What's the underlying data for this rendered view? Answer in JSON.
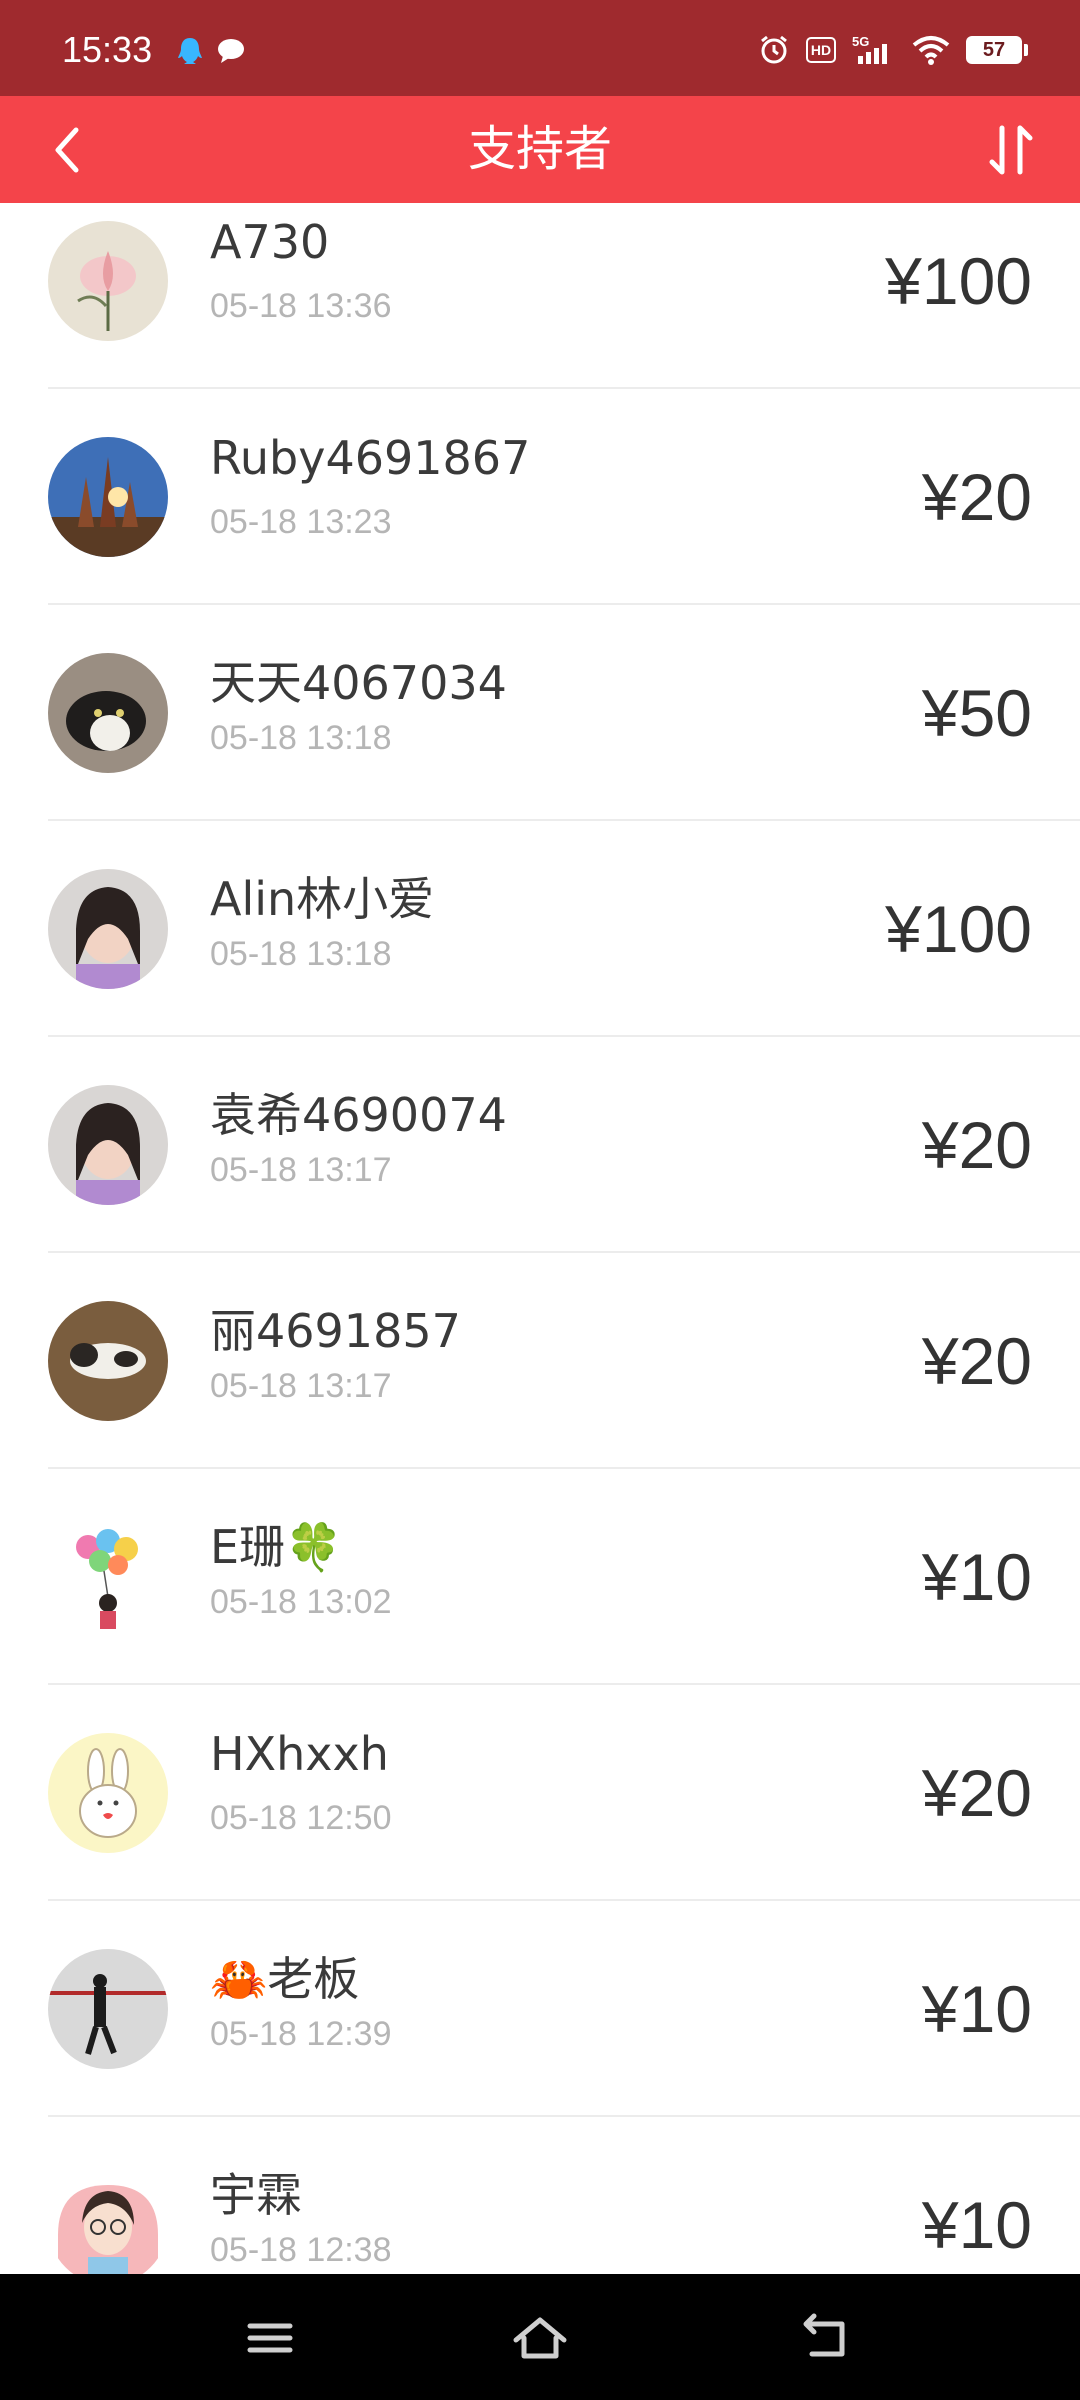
{
  "status_bar": {
    "time": "15:33",
    "left_icons": [
      "qq-icon",
      "message-icon"
    ],
    "right_icons": [
      "alarm-icon",
      "hd-icon",
      "5g-signal-icon",
      "wifi-icon"
    ],
    "hd_label": "HD",
    "battery_level": "57"
  },
  "header": {
    "title": "支持者",
    "back_icon": "chevron-left-icon",
    "sort_icon": "sort-arrows-icon",
    "background_color": "#f4444a"
  },
  "supporters": [
    {
      "name": "A730",
      "time": "05-18 13:36",
      "amount": "¥100",
      "avatar": "lotus-painting"
    },
    {
      "name": "Ruby4691867",
      "time": "05-18 13:23",
      "amount": "¥20",
      "avatar": "pagoda"
    },
    {
      "name": "天天4067034",
      "time": "05-18 13:18",
      "amount": "¥50",
      "avatar": "cat-black-white"
    },
    {
      "name": "Alin林小爱",
      "time": "05-18 13:18",
      "amount": "¥100",
      "avatar": "woman-portrait"
    },
    {
      "name": "袁希4690074",
      "time": "05-18 13:17",
      "amount": "¥20",
      "avatar": "woman-portrait"
    },
    {
      "name": "丽4691857",
      "time": "05-18 13:17",
      "amount": "¥20",
      "avatar": "cat-lying"
    },
    {
      "name": "E珊🍀",
      "time": "05-18 13:02",
      "amount": "¥10",
      "avatar": "balloons-cartoon"
    },
    {
      "name": "HXhxxh",
      "time": "05-18 12:50",
      "amount": "¥20",
      "avatar": "rabbit-cartoon"
    },
    {
      "name": "🦀老板",
      "time": "05-18 12:39",
      "amount": "¥10",
      "avatar": "person-walking"
    },
    {
      "name": "宇霖",
      "time": "05-18 12:38",
      "amount": "¥10",
      "avatar": "girl-cartoon"
    }
  ],
  "nav_bar": {
    "buttons": [
      "menu-icon",
      "home-icon",
      "back-icon"
    ]
  }
}
